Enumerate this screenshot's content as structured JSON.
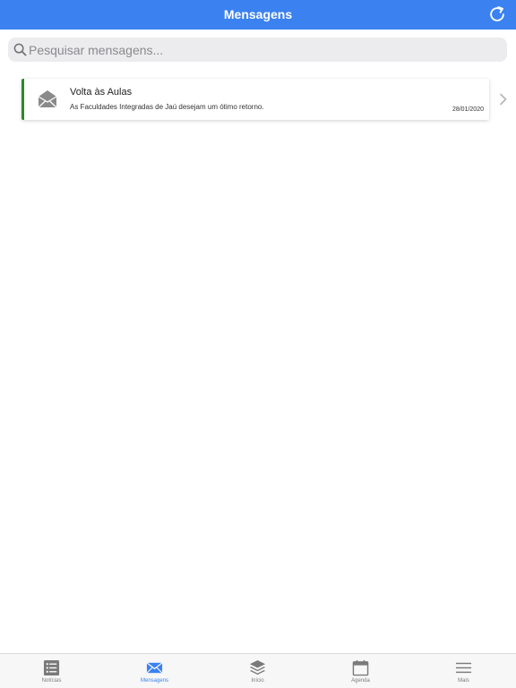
{
  "header": {
    "title": "Mensagens",
    "refresh_icon": "refresh-icon"
  },
  "search": {
    "placeholder": "Pesquisar mensagens...",
    "value": "",
    "icon": "search-icon"
  },
  "messages": [
    {
      "title": "Volta às Aulas",
      "body": "As Faculdades Integradas de Jaú desejam um ótimo retorno.",
      "date": "28/01/2020",
      "icon": "open-envelope-icon",
      "read": true,
      "accent_color": "#2a8a2a"
    }
  ],
  "tabbar": {
    "active": "Mensagens",
    "tabs": [
      {
        "label": "Notícias",
        "icon": "news-list-icon"
      },
      {
        "label": "Mensagens",
        "icon": "envelope-icon"
      },
      {
        "label": "Início",
        "icon": "layers-icon"
      },
      {
        "label": "Agenda",
        "icon": "calendar-icon"
      },
      {
        "label": "Mais",
        "icon": "menu-icon"
      }
    ]
  },
  "colors": {
    "primary": "#3b82f0",
    "inactive": "#7a7a7a",
    "search_bg": "#ececee"
  }
}
